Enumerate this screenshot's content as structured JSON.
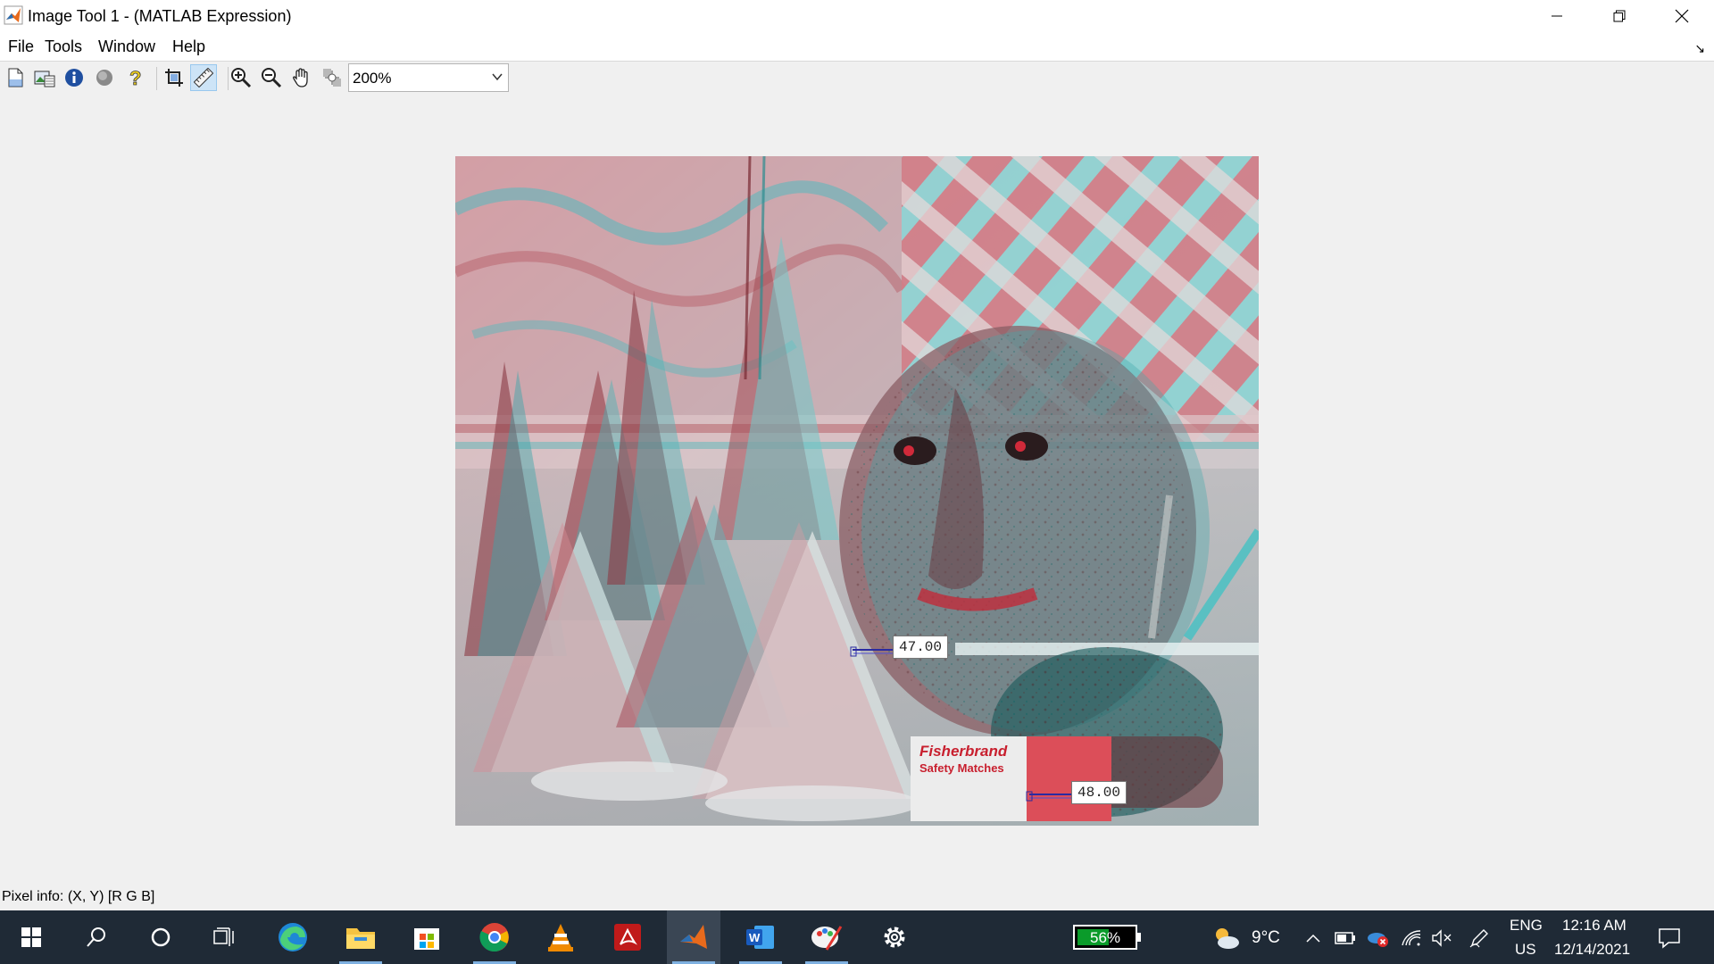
{
  "window": {
    "title": "Image Tool 1 - (MATLAB Expression)"
  },
  "menu": {
    "items": [
      "File",
      "Tools",
      "Window",
      "Help"
    ]
  },
  "toolbar": {
    "zoom_value": "200%",
    "tools": [
      "new-figure-icon",
      "export-image-icon",
      "image-information-icon",
      "adjust-contrast-icon",
      "help-icon",
      "crop-icon",
      "measure-distance-icon",
      "zoom-in-icon",
      "zoom-out-icon",
      "pan-icon",
      "pixel-region-icon"
    ]
  },
  "image": {
    "box_text": [
      "Fisherbrand",
      "Safety Matches"
    ],
    "distance_labels": [
      "47.00",
      "48.00"
    ]
  },
  "status": {
    "pixel_info": "Pixel info: (X, Y)  [R G B]"
  },
  "taskbar": {
    "battery_percent": "56%",
    "battery_level": 0.56,
    "weather_temp": "9°C",
    "language": "ENG",
    "region": "US",
    "time": "12:16 AM",
    "date": "12/14/2021"
  }
}
